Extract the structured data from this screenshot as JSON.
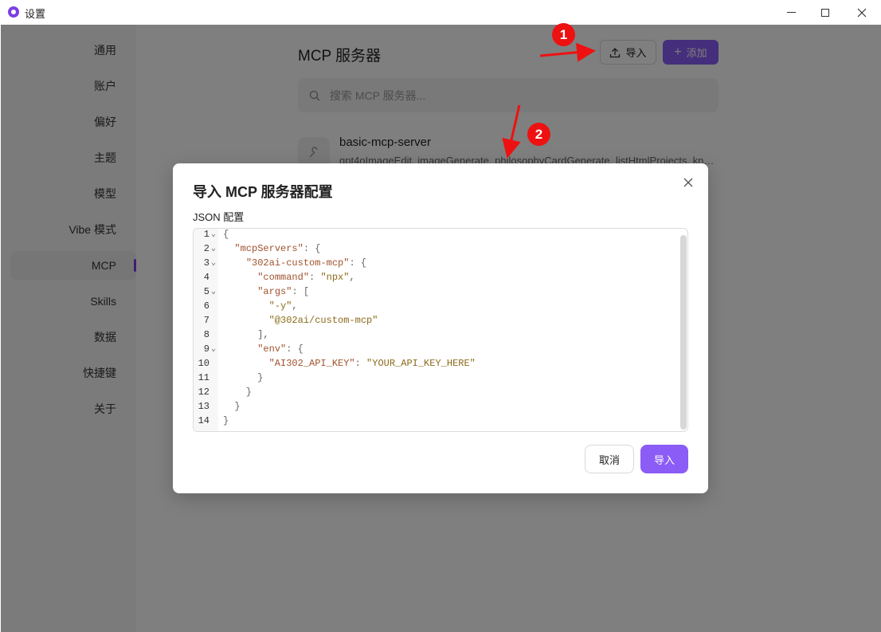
{
  "window": {
    "title": "设置",
    "controls": [
      "minimize",
      "maximize",
      "close"
    ]
  },
  "sidebar": {
    "items": [
      {
        "label": "通用"
      },
      {
        "label": "账户"
      },
      {
        "label": "偏好"
      },
      {
        "label": "主题"
      },
      {
        "label": "模型"
      },
      {
        "label": "Vibe 模式"
      },
      {
        "label": "MCP",
        "active": true
      },
      {
        "label": "Skills"
      },
      {
        "label": "数据"
      },
      {
        "label": "快捷键"
      },
      {
        "label": "关于"
      }
    ]
  },
  "main": {
    "title": "MCP 服务器",
    "import_label": "导入",
    "add_label": "添加",
    "search_placeholder": "搜索 MCP 服务器...",
    "servers": [
      {
        "name": "basic-mcp-server",
        "description": "gpt4oImageEdit, imageGenerate, philosophyCardGenerate, listHtmlProjects, kno..."
      }
    ]
  },
  "dialog": {
    "title": "导入 MCP 服务器配置",
    "field_label": "JSON 配置",
    "cancel_label": "取消",
    "import_label": "导入",
    "code_lines": [
      "{",
      "  \"mcpServers\": {",
      "    \"302ai-custom-mcp\": {",
      "      \"command\": \"npx\",",
      "      \"args\": [",
      "        \"-y\",",
      "        \"@302ai/custom-mcp\"",
      "      ],",
      "      \"env\": {",
      "        \"AI302_API_KEY\": \"YOUR_API_KEY_HERE\"",
      "      }",
      "    }",
      "  }",
      "}"
    ],
    "foldable_lines": [
      1,
      2,
      3,
      5,
      9
    ]
  },
  "annotations": {
    "markers": [
      "1",
      "2"
    ],
    "color": "#ee1111"
  },
  "colors": {
    "accent": "#8b5cf6",
    "brand": "#7b3fe4"
  }
}
